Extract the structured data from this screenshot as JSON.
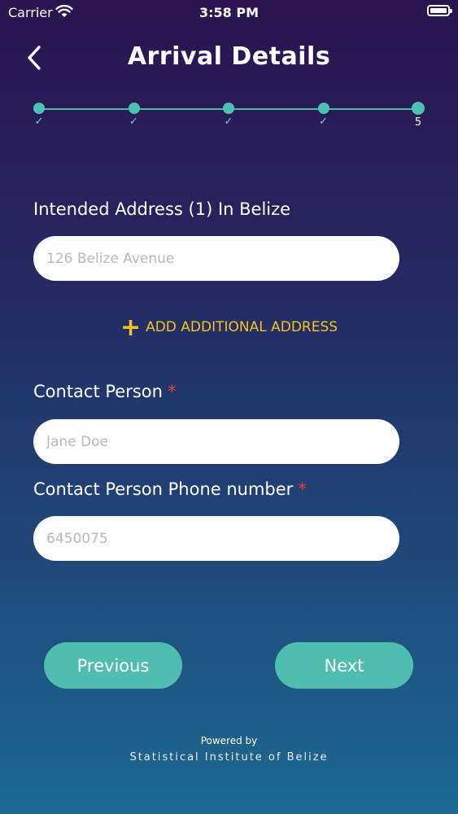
{
  "status_bar": {
    "carrier": "Carrier",
    "time": "3:58 PM"
  },
  "header": {
    "title": "Arrival Details"
  },
  "stepper": {
    "steps": [
      {
        "mark": "✓"
      },
      {
        "mark": "✓"
      },
      {
        "mark": "✓"
      },
      {
        "mark": "✓"
      },
      {
        "mark": "5"
      }
    ]
  },
  "form": {
    "address_label": "Intended Address (1) In Belize",
    "address_placeholder": "126 Belize Avenue",
    "add_address_label": "ADD ADDITIONAL ADDRESS",
    "contact_label": "Contact Person",
    "contact_placeholder": "Jane Doe",
    "phone_label": "Contact Person Phone number",
    "phone_placeholder": "6450075",
    "required_mark": "*"
  },
  "buttons": {
    "previous": "Previous",
    "next": "Next"
  },
  "footer": {
    "powered": "Powered by",
    "org": "Statistical Institute of Belize"
  },
  "colors": {
    "accent": "#4fbdaf",
    "link": "#f4c21e",
    "required": "#e0403f"
  }
}
